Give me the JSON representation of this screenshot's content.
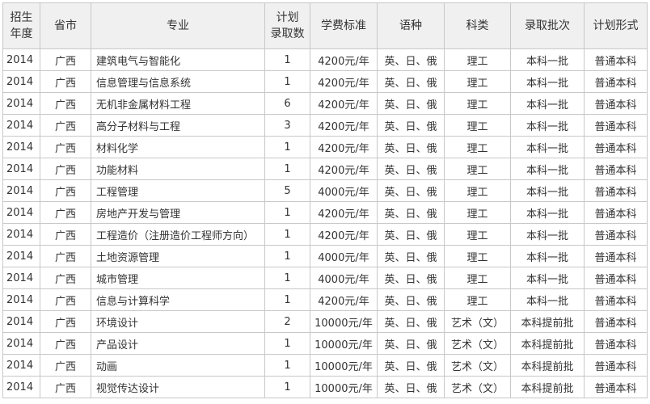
{
  "headers": [
    [
      "招生",
      "年度"
    ],
    [
      "省市"
    ],
    [
      "专业"
    ],
    [
      "计划",
      "录取数"
    ],
    [
      "学费标准"
    ],
    [
      "语种"
    ],
    [
      "科类"
    ],
    [
      "录取批次"
    ],
    [
      "计划形式"
    ]
  ],
  "rows": [
    [
      "2014",
      "广西",
      "建筑电气与智能化",
      "1",
      "4200元/年",
      "英、日、俄",
      "理工",
      "本科一批",
      "普通本科"
    ],
    [
      "2014",
      "广西",
      "信息管理与信息系统",
      "1",
      "4200元/年",
      "英、日、俄",
      "理工",
      "本科一批",
      "普通本科"
    ],
    [
      "2014",
      "广西",
      "无机非金属材料工程",
      "6",
      "4200元/年",
      "英、日、俄",
      "理工",
      "本科一批",
      "普通本科"
    ],
    [
      "2014",
      "广西",
      "高分子材料与工程",
      "3",
      "4200元/年",
      "英、日、俄",
      "理工",
      "本科一批",
      "普通本科"
    ],
    [
      "2014",
      "广西",
      "材料化学",
      "1",
      "4200元/年",
      "英、日、俄",
      "理工",
      "本科一批",
      "普通本科"
    ],
    [
      "2014",
      "广西",
      "功能材料",
      "1",
      "4200元/年",
      "英、日、俄",
      "理工",
      "本科一批",
      "普通本科"
    ],
    [
      "2014",
      "广西",
      "工程管理",
      "5",
      "4000元/年",
      "英、日、俄",
      "理工",
      "本科一批",
      "普通本科"
    ],
    [
      "2014",
      "广西",
      "房地产开发与管理",
      "1",
      "4200元/年",
      "英、日、俄",
      "理工",
      "本科一批",
      "普通本科"
    ],
    [
      "2014",
      "广西",
      "工程造价（注册造价工程师方向）",
      "1",
      "4200元/年",
      "英、日、俄",
      "理工",
      "本科一批",
      "普通本科"
    ],
    [
      "2014",
      "广西",
      "土地资源管理",
      "1",
      "4000元/年",
      "英、日、俄",
      "理工",
      "本科一批",
      "普通本科"
    ],
    [
      "2014",
      "广西",
      "城市管理",
      "1",
      "4000元/年",
      "英、日、俄",
      "理工",
      "本科一批",
      "普通本科"
    ],
    [
      "2014",
      "广西",
      "信息与计算科学",
      "1",
      "4200元/年",
      "英、日、俄",
      "理工",
      "本科一批",
      "普通本科"
    ],
    [
      "2014",
      "广西",
      "环境设计",
      "2",
      "10000元/年",
      "英、日、俄",
      "艺术（文）",
      "本科提前批",
      "普通本科"
    ],
    [
      "2014",
      "广西",
      "产品设计",
      "1",
      "10000元/年",
      "英、日、俄",
      "艺术（文）",
      "本科提前批",
      "普通本科"
    ],
    [
      "2014",
      "广西",
      "动画",
      "1",
      "10000元/年",
      "英、日、俄",
      "艺术（文）",
      "本科提前批",
      "普通本科"
    ],
    [
      "2014",
      "广西",
      "视觉传达设计",
      "1",
      "10000元/年",
      "英、日、俄",
      "艺术（文）",
      "本科提前批",
      "普通本科"
    ]
  ]
}
